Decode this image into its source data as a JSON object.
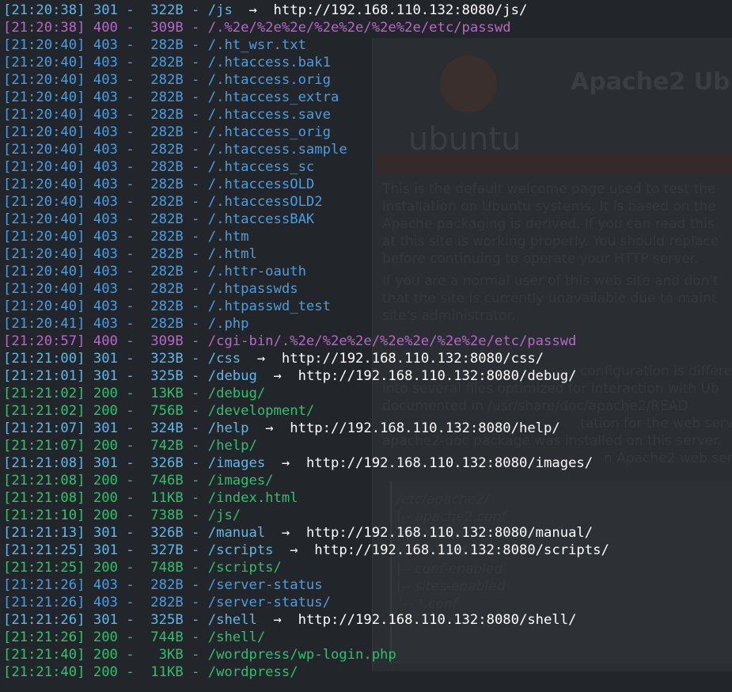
{
  "colors": {
    "terminal_bg": "#22262b",
    "status_200": "#2fbf6e",
    "status_301": "#5fb8e8",
    "status_400": "#b667c8",
    "status_403": "#4a9de0",
    "redirect_target": "#ffffff"
  },
  "background_window": {
    "title": "Apache2 Ub",
    "wordmark": "ubuntu",
    "para1": [
      "This is the default welcome page used to test the",
      "installation on Ubuntu systems. It is based on the",
      "Apache packaging is derived. If you can read this",
      "at this site is working properly. You should replace",
      "before continuing to operate your HTTP server."
    ],
    "para2": [
      "If you are a normal user of this web site and don't",
      "that the site is currently unavailable due to maint",
      "site's administrator."
    ],
    "para3": [
      "configuration is differen",
      "into several files optimized for interaction with Ub",
      "documented in /usr/share/doc/apache2/READ",
      "tation for the web serve",
      "apache2-doc package was installed on this server.",
      "n Apache2 web serv"
    ],
    "code": [
      "/etc/apache2/",
      "|-- apache2.conf",
      "|       |-- *.load",
      "|       `-- *.conf",
      "|-- conf-enabled",
      "|-- sites-enabled",
      "        `-- *.conf"
    ]
  },
  "lines": [
    {
      "time": "[21:20:38]",
      "status": "301",
      "size": "322B",
      "path": "/js",
      "redirect": "http://192.168.110.132:8080/js/"
    },
    {
      "time": "[21:20:38]",
      "status": "400",
      "size": "309B",
      "path": "/.%2e/%2e%2e/%2e%2e/%2e%2e/etc/passwd",
      "redirect": ""
    },
    {
      "time": "[21:20:40]",
      "status": "403",
      "size": "282B",
      "path": "/.ht_wsr.txt",
      "redirect": ""
    },
    {
      "time": "[21:20:40]",
      "status": "403",
      "size": "282B",
      "path": "/.htaccess.bak1",
      "redirect": ""
    },
    {
      "time": "[21:20:40]",
      "status": "403",
      "size": "282B",
      "path": "/.htaccess.orig",
      "redirect": ""
    },
    {
      "time": "[21:20:40]",
      "status": "403",
      "size": "282B",
      "path": "/.htaccess_extra",
      "redirect": ""
    },
    {
      "time": "[21:20:40]",
      "status": "403",
      "size": "282B",
      "path": "/.htaccess.save",
      "redirect": ""
    },
    {
      "time": "[21:20:40]",
      "status": "403",
      "size": "282B",
      "path": "/.htaccess_orig",
      "redirect": ""
    },
    {
      "time": "[21:20:40]",
      "status": "403",
      "size": "282B",
      "path": "/.htaccess.sample",
      "redirect": ""
    },
    {
      "time": "[21:20:40]",
      "status": "403",
      "size": "282B",
      "path": "/.htaccess_sc",
      "redirect": ""
    },
    {
      "time": "[21:20:40]",
      "status": "403",
      "size": "282B",
      "path": "/.htaccessOLD",
      "redirect": ""
    },
    {
      "time": "[21:20:40]",
      "status": "403",
      "size": "282B",
      "path": "/.htaccessOLD2",
      "redirect": ""
    },
    {
      "time": "[21:20:40]",
      "status": "403",
      "size": "282B",
      "path": "/.htaccessBAK",
      "redirect": ""
    },
    {
      "time": "[21:20:40]",
      "status": "403",
      "size": "282B",
      "path": "/.htm",
      "redirect": ""
    },
    {
      "time": "[21:20:40]",
      "status": "403",
      "size": "282B",
      "path": "/.html",
      "redirect": ""
    },
    {
      "time": "[21:20:40]",
      "status": "403",
      "size": "282B",
      "path": "/.httr-oauth",
      "redirect": ""
    },
    {
      "time": "[21:20:40]",
      "status": "403",
      "size": "282B",
      "path": "/.htpasswds",
      "redirect": ""
    },
    {
      "time": "[21:20:40]",
      "status": "403",
      "size": "282B",
      "path": "/.htpasswd_test",
      "redirect": ""
    },
    {
      "time": "[21:20:41]",
      "status": "403",
      "size": "282B",
      "path": "/.php",
      "redirect": ""
    },
    {
      "time": "[21:20:57]",
      "status": "400",
      "size": "309B",
      "path": "/cgi-bin/.%2e/%2e%2e/%2e%2e/%2e%2e/etc/passwd",
      "redirect": ""
    },
    {
      "time": "[21:21:00]",
      "status": "301",
      "size": "323B",
      "path": "/css",
      "redirect": "http://192.168.110.132:8080/css/"
    },
    {
      "time": "[21:21:01]",
      "status": "301",
      "size": "325B",
      "path": "/debug",
      "redirect": "http://192.168.110.132:8080/debug/"
    },
    {
      "time": "[21:21:02]",
      "status": "200",
      "size": "13KB",
      "path": "/debug/",
      "redirect": ""
    },
    {
      "time": "[21:21:02]",
      "status": "200",
      "size": "756B",
      "path": "/development/",
      "redirect": ""
    },
    {
      "time": "[21:21:07]",
      "status": "301",
      "size": "324B",
      "path": "/help",
      "redirect": "http://192.168.110.132:8080/help/"
    },
    {
      "time": "[21:21:07]",
      "status": "200",
      "size": "742B",
      "path": "/help/",
      "redirect": ""
    },
    {
      "time": "[21:21:08]",
      "status": "301",
      "size": "326B",
      "path": "/images",
      "redirect": "http://192.168.110.132:8080/images/"
    },
    {
      "time": "[21:21:08]",
      "status": "200",
      "size": "746B",
      "path": "/images/",
      "redirect": ""
    },
    {
      "time": "[21:21:08]",
      "status": "200",
      "size": "11KB",
      "path": "/index.html",
      "redirect": ""
    },
    {
      "time": "[21:21:10]",
      "status": "200",
      "size": "738B",
      "path": "/js/",
      "redirect": ""
    },
    {
      "time": "[21:21:13]",
      "status": "301",
      "size": "326B",
      "path": "/manual",
      "redirect": "http://192.168.110.132:8080/manual/"
    },
    {
      "time": "[21:21:25]",
      "status": "301",
      "size": "327B",
      "path": "/scripts",
      "redirect": "http://192.168.110.132:8080/scripts/"
    },
    {
      "time": "[21:21:25]",
      "status": "200",
      "size": "748B",
      "path": "/scripts/",
      "redirect": ""
    },
    {
      "time": "[21:21:26]",
      "status": "403",
      "size": "282B",
      "path": "/server-status",
      "redirect": ""
    },
    {
      "time": "[21:21:26]",
      "status": "403",
      "size": "282B",
      "path": "/server-status/",
      "redirect": ""
    },
    {
      "time": "[21:21:26]",
      "status": "301",
      "size": "325B",
      "path": "/shell",
      "redirect": "http://192.168.110.132:8080/shell/"
    },
    {
      "time": "[21:21:26]",
      "status": "200",
      "size": "744B",
      "path": "/shell/",
      "redirect": ""
    },
    {
      "time": "[21:21:40]",
      "status": "200",
      "size": "3KB",
      "path": "/wordpress/wp-login.php",
      "redirect": ""
    },
    {
      "time": "[21:21:40]",
      "status": "200",
      "size": "11KB",
      "path": "/wordpress/",
      "redirect": ""
    }
  ]
}
